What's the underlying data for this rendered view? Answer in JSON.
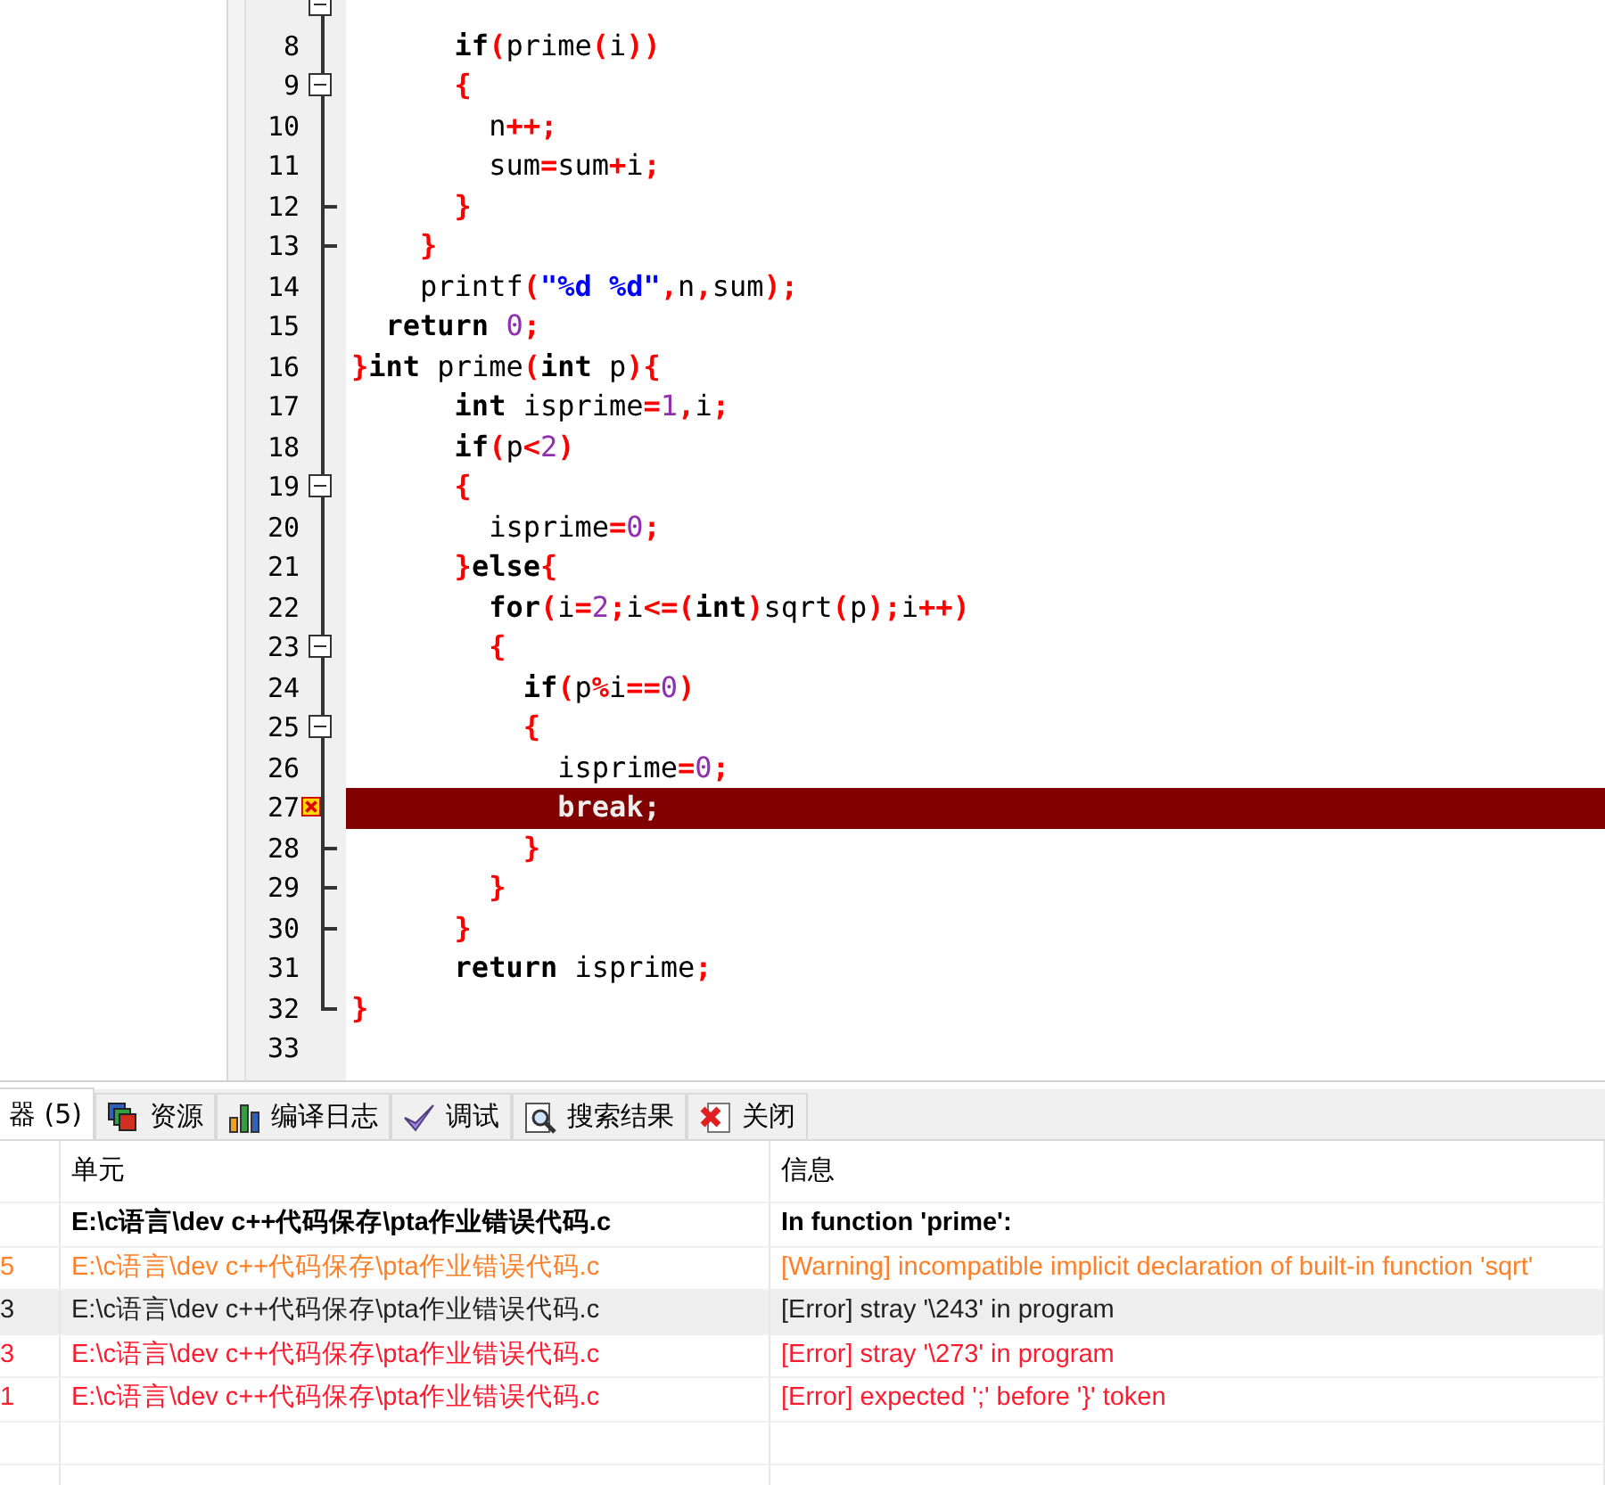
{
  "editor": {
    "lines": [
      {
        "kind": "fold_start",
        "expanded": true,
        "error": false
      },
      {
        "number": "8",
        "kind": "fold_inner",
        "error": false,
        "tokens": [
          {
            "text": "      if",
            "kind": "keyword"
          },
          {
            "text": "(",
            "kind": "symbol"
          },
          {
            "text": "prime",
            "kind": "ident"
          },
          {
            "text": "(",
            "kind": "symbol"
          },
          {
            "text": "i",
            "kind": "ident"
          },
          {
            "text": "))",
            "kind": "symbol"
          }
        ]
      },
      {
        "number": "9",
        "kind": "fold_start",
        "expanded": true,
        "error": false,
        "tokens": [
          {
            "text": "      {",
            "kind": "symbol"
          }
        ]
      },
      {
        "number": "10",
        "kind": "fold_inner",
        "error": false,
        "tokens": [
          {
            "text": "        n",
            "kind": "ident"
          },
          {
            "text": "++;",
            "kind": "symbol"
          }
        ]
      },
      {
        "number": "11",
        "kind": "fold_inner",
        "error": false,
        "tokens": [
          {
            "text": "        sum",
            "kind": "ident"
          },
          {
            "text": "=",
            "kind": "symbol"
          },
          {
            "text": "sum",
            "kind": "ident"
          },
          {
            "text": "+",
            "kind": "symbol"
          },
          {
            "text": "i",
            "kind": "ident"
          },
          {
            "text": ";",
            "kind": "symbol"
          }
        ]
      },
      {
        "number": "12",
        "kind": "fold_end",
        "error": false,
        "tokens": [
          {
            "text": "      }",
            "kind": "symbol"
          }
        ]
      },
      {
        "number": "13",
        "kind": "fold_end",
        "error": false,
        "tokens": [
          {
            "text": "    }",
            "kind": "symbol"
          }
        ]
      },
      {
        "number": "14",
        "kind": "fold_inner",
        "error": false,
        "tokens": [
          {
            "text": "    printf",
            "kind": "ident"
          },
          {
            "text": "(",
            "kind": "symbol"
          },
          {
            "text": "\"%d %d\"",
            "kind": "string"
          },
          {
            "text": ",",
            "kind": "symbol"
          },
          {
            "text": "n",
            "kind": "ident"
          },
          {
            "text": ",",
            "kind": "symbol"
          },
          {
            "text": "sum",
            "kind": "ident"
          },
          {
            "text": ");",
            "kind": "symbol"
          }
        ]
      },
      {
        "number": "15",
        "kind": "fold_inner",
        "error": false,
        "tokens": [
          {
            "text": "  return",
            "kind": "keyword"
          },
          {
            "text": " 0",
            "kind": "number"
          },
          {
            "text": ";",
            "kind": "symbol"
          }
        ]
      },
      {
        "number": "16",
        "kind": "fold_inner",
        "error": false,
        "tokens": [
          {
            "text": "}",
            "kind": "symbol"
          },
          {
            "text": "int",
            "kind": "keyword"
          },
          {
            "text": " prime",
            "kind": "ident"
          },
          {
            "text": "(",
            "kind": "symbol"
          },
          {
            "text": "int",
            "kind": "keyword"
          },
          {
            "text": " p",
            "kind": "ident"
          },
          {
            "text": "){",
            "kind": "symbol"
          }
        ]
      },
      {
        "number": "17",
        "kind": "fold_inner",
        "error": false,
        "tokens": [
          {
            "text": "      int",
            "kind": "keyword"
          },
          {
            "text": " isprime",
            "kind": "ident"
          },
          {
            "text": "=",
            "kind": "symbol"
          },
          {
            "text": "1",
            "kind": "number"
          },
          {
            "text": ",",
            "kind": "symbol"
          },
          {
            "text": "i",
            "kind": "ident"
          },
          {
            "text": ";",
            "kind": "symbol"
          }
        ]
      },
      {
        "number": "18",
        "kind": "fold_inner",
        "error": false,
        "tokens": [
          {
            "text": "      if",
            "kind": "keyword"
          },
          {
            "text": "(",
            "kind": "symbol"
          },
          {
            "text": "p",
            "kind": "ident"
          },
          {
            "text": "<",
            "kind": "symbol"
          },
          {
            "text": "2",
            "kind": "number"
          },
          {
            "text": ")",
            "kind": "symbol"
          }
        ]
      },
      {
        "number": "19",
        "kind": "fold_start",
        "expanded": true,
        "error": false,
        "tokens": [
          {
            "text": "      {",
            "kind": "symbol"
          }
        ]
      },
      {
        "number": "20",
        "kind": "fold_inner",
        "error": false,
        "tokens": [
          {
            "text": "        isprime",
            "kind": "ident"
          },
          {
            "text": "=",
            "kind": "symbol"
          },
          {
            "text": "0",
            "kind": "number"
          },
          {
            "text": ";",
            "kind": "symbol"
          }
        ]
      },
      {
        "number": "21",
        "kind": "fold_inner",
        "error": false,
        "tokens": [
          {
            "text": "      }",
            "kind": "symbol"
          },
          {
            "text": "else",
            "kind": "keyword"
          },
          {
            "text": "{",
            "kind": "symbol"
          }
        ]
      },
      {
        "number": "22",
        "kind": "fold_inner",
        "error": false,
        "tokens": [
          {
            "text": "        for",
            "kind": "keyword"
          },
          {
            "text": "(",
            "kind": "symbol"
          },
          {
            "text": "i",
            "kind": "ident"
          },
          {
            "text": "=",
            "kind": "symbol"
          },
          {
            "text": "2",
            "kind": "number"
          },
          {
            "text": ";",
            "kind": "symbol"
          },
          {
            "text": "i",
            "kind": "ident"
          },
          {
            "text": "<=(",
            "kind": "symbol"
          },
          {
            "text": "int",
            "kind": "keyword"
          },
          {
            "text": ")",
            "kind": "symbol"
          },
          {
            "text": "sqrt",
            "kind": "ident"
          },
          {
            "text": "(",
            "kind": "symbol"
          },
          {
            "text": "p",
            "kind": "ident"
          },
          {
            "text": ");",
            "kind": "symbol"
          },
          {
            "text": "i",
            "kind": "ident"
          },
          {
            "text": "++)",
            "kind": "symbol"
          }
        ]
      },
      {
        "number": "23",
        "kind": "fold_start",
        "expanded": true,
        "error": false,
        "tokens": [
          {
            "text": "        {",
            "kind": "symbol"
          }
        ]
      },
      {
        "number": "24",
        "kind": "fold_inner",
        "error": false,
        "tokens": [
          {
            "text": "          if",
            "kind": "keyword"
          },
          {
            "text": "(",
            "kind": "symbol"
          },
          {
            "text": "p",
            "kind": "ident"
          },
          {
            "text": "%",
            "kind": "symbol"
          },
          {
            "text": "i",
            "kind": "ident"
          },
          {
            "text": "==",
            "kind": "symbol"
          },
          {
            "text": "0",
            "kind": "number"
          },
          {
            "text": ")",
            "kind": "symbol"
          }
        ]
      },
      {
        "number": "25",
        "kind": "fold_start",
        "expanded": true,
        "error": false,
        "tokens": [
          {
            "text": "          {",
            "kind": "symbol"
          }
        ]
      },
      {
        "number": "26",
        "kind": "fold_inner",
        "error": false,
        "tokens": [
          {
            "text": "            isprime",
            "kind": "ident"
          },
          {
            "text": "=",
            "kind": "symbol"
          },
          {
            "text": "0",
            "kind": "number"
          },
          {
            "text": ";",
            "kind": "symbol"
          }
        ]
      },
      {
        "number": "27",
        "kind": "fold_inner",
        "error": true,
        "tokens": [
          {
            "text": "            break",
            "kind": "keyword"
          },
          {
            "text": ";",
            "kind": "symbol"
          }
        ]
      },
      {
        "number": "28",
        "kind": "fold_end",
        "error": false,
        "tokens": [
          {
            "text": "          }",
            "kind": "symbol"
          }
        ]
      },
      {
        "number": "29",
        "kind": "fold_end",
        "error": false,
        "tokens": [
          {
            "text": "        }",
            "kind": "symbol"
          }
        ]
      },
      {
        "number": "30",
        "kind": "fold_end",
        "error": false,
        "tokens": [
          {
            "text": "      }",
            "kind": "symbol"
          }
        ]
      },
      {
        "number": "31",
        "kind": "fold_inner",
        "error": false,
        "tokens": [
          {
            "text": "      return",
            "kind": "keyword"
          },
          {
            "text": " isprime",
            "kind": "ident"
          },
          {
            "text": ";",
            "kind": "symbol"
          }
        ]
      },
      {
        "number": "32",
        "kind": "fold_last",
        "error": false,
        "tokens": [
          {
            "text": "}",
            "kind": "symbol"
          }
        ]
      },
      {
        "number": "33",
        "kind": "plain",
        "error": false
      }
    ]
  },
  "tabs": [
    {
      "label": "器 (5)",
      "selected": true
    },
    {
      "label": "资源",
      "selected": false
    },
    {
      "label": "编译日志",
      "selected": false
    },
    {
      "label": "调试",
      "selected": false
    },
    {
      "label": "搜索结果",
      "selected": false
    },
    {
      "label": "关闭",
      "selected": false
    }
  ],
  "table": {
    "columns": [
      "单元",
      "信息"
    ],
    "rows": [
      {
        "kind": "header",
        "selected": false,
        "unit": "E:\\c语言\\dev c++代码保存\\pta作业错误代码.c",
        "message": "In function 'prime':"
      },
      {
        "kind": "warning",
        "selected": false,
        "line": "5",
        "unit": "E:\\c语言\\dev c++代码保存\\pta作业错误代码.c",
        "message": "[Warning] incompatible implicit declaration of built-in function 'sqrt'"
      },
      {
        "kind": "error",
        "selected": true,
        "line": "3",
        "unit": "E:\\c语言\\dev c++代码保存\\pta作业错误代码.c",
        "message": "[Error] stray '\\243' in program"
      },
      {
        "kind": "error",
        "selected": false,
        "line": "3",
        "unit": "E:\\c语言\\dev c++代码保存\\pta作业错误代码.c",
        "message": "[Error] stray '\\273' in program"
      },
      {
        "kind": "error",
        "selected": false,
        "line": "1",
        "unit": "E:\\c语言\\dev c++代码保存\\pta作业错误代码.c",
        "message": "[Error] expected ';' before '}' token"
      }
    ]
  }
}
